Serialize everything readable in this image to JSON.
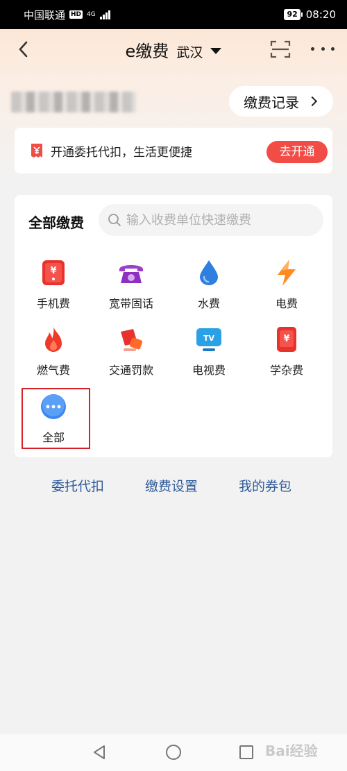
{
  "status_bar": {
    "carrier": "中国联通",
    "hd": "HD",
    "network": "4G",
    "battery": "92",
    "time": "08:20"
  },
  "nav": {
    "title": "e缴费",
    "city": "武汉"
  },
  "account": {
    "records_label": "缴费记录"
  },
  "auto_debit": {
    "text": "开通委托代扣，生活更便捷",
    "button": "去开通"
  },
  "pay": {
    "title": "全部缴费",
    "search_placeholder": "输入收费单位快速缴费",
    "items": [
      {
        "label": "手机费",
        "icon": "phone-bill-icon"
      },
      {
        "label": "宽带固话",
        "icon": "telephone-icon"
      },
      {
        "label": "水费",
        "icon": "water-drop-icon"
      },
      {
        "label": "电费",
        "icon": "lightning-icon"
      },
      {
        "label": "燃气费",
        "icon": "flame-icon"
      },
      {
        "label": "交通罚款",
        "icon": "traffic-fine-icon"
      },
      {
        "label": "电视费",
        "icon": "tv-icon"
      },
      {
        "label": "学杂费",
        "icon": "tuition-bill-icon"
      },
      {
        "label": "全部",
        "icon": "more-dots-icon"
      }
    ]
  },
  "links": [
    "委托代扣",
    "缴费设置",
    "我的券包"
  ],
  "watermark": "Bai经验",
  "colors": {
    "accent_red": "#f14c45",
    "link_blue": "#2e5b9a",
    "highlight_red": "#d32029"
  }
}
